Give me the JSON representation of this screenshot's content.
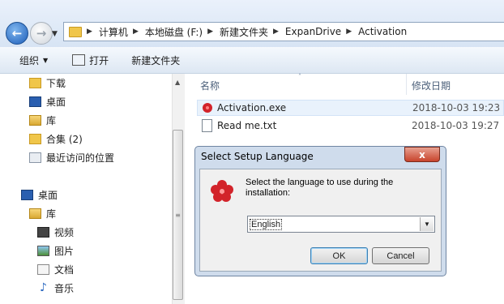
{
  "breadcrumb": [
    "计算机",
    "本地磁盘 (F:)",
    "新建文件夹",
    "ExpanDrive",
    "Activation"
  ],
  "toolbar": {
    "organize": "组织",
    "open": "打开",
    "new_folder": "新建文件夹"
  },
  "nav": {
    "items_top": [
      "下载",
      "桌面",
      "库",
      "合集 (2)",
      "最近访问的位置"
    ],
    "items_bottom": [
      "桌面",
      "库",
      "视频",
      "图片",
      "文档",
      "音乐"
    ]
  },
  "columns": {
    "name": "名称",
    "date": "修改日期"
  },
  "files": [
    {
      "name": "Activation.exe",
      "date": "2018-10-03 19:23"
    },
    {
      "name": "Read me.txt",
      "date": "2018-10-03 19:27"
    }
  ],
  "dialog": {
    "title": "Select Setup Language",
    "close": "x",
    "message": "Select the language to use during the installation:",
    "language": "English",
    "ok": "OK",
    "cancel": "Cancel"
  },
  "colors": {
    "accent": "#1c5db8",
    "close_red": "#c8442c",
    "dialog_bg": "#cfdcec"
  },
  "icons": [
    "back-arrow-icon",
    "forward-arrow-icon",
    "folder-icon",
    "open-icon",
    "app-flower-icon",
    "text-file-icon"
  ]
}
